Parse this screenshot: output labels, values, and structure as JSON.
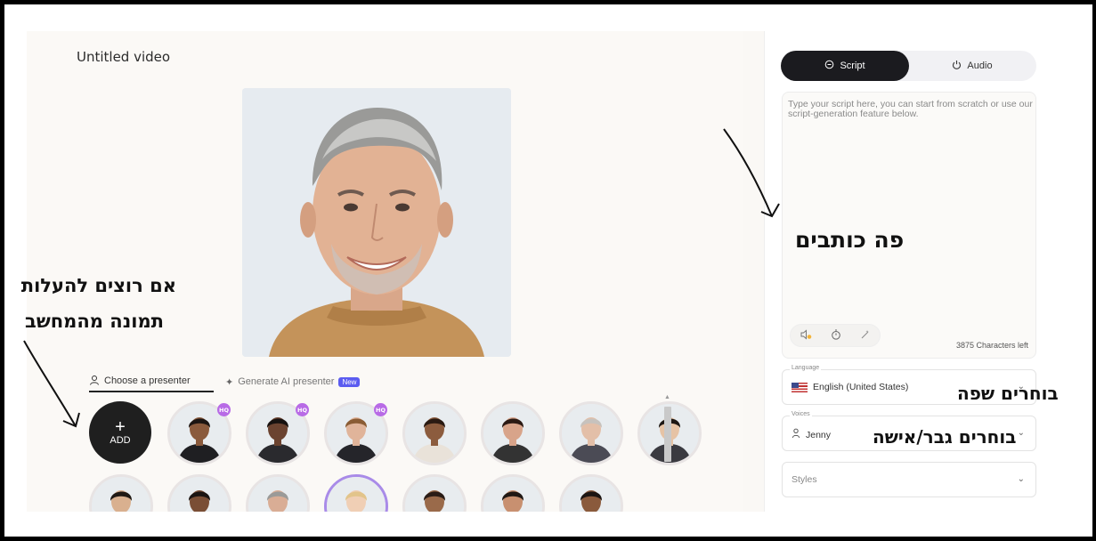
{
  "app": {
    "video_title": "Untitled video"
  },
  "presenter_tabs": {
    "choose": "Choose a presenter",
    "generate": "Generate AI presenter",
    "new_badge": "New"
  },
  "grid": {
    "add_label": "ADD",
    "hq_badge": "HQ",
    "hq_count": 3
  },
  "script_panel": {
    "tabs": [
      "Script",
      "Audio"
    ],
    "placeholder": "Type your script here, you can start from scratch or use our script-generation feature below.",
    "chars_left": "3875 Characters left",
    "language": {
      "label": "Language",
      "value": "English (United States)"
    },
    "voices": {
      "label": "Voices",
      "value": "Jenny"
    },
    "styles": {
      "placeholder": "Styles"
    }
  },
  "annotations": {
    "write_here": "פה כותבים",
    "upload_line1": "אם רוצים להעלות",
    "upload_line2": "תמונה מהמחשב",
    "choose_language": "בוחרים שפה",
    "choose_gender": "בוחרים גבר/אישה"
  },
  "colors": {
    "accent_dark": "#1b1b1f",
    "new_badge": "#5b5cf0",
    "hq_badge": "#b86be6",
    "selected_ring": "#a98be8"
  },
  "icons": [
    "user-icon",
    "sparkle-icon",
    "plus-icon",
    "chat-bubble-icon",
    "power-icon",
    "sound-icon",
    "timer-icon",
    "magic-icon",
    "flag-us-icon",
    "person-icon",
    "chevron-down-icon"
  ]
}
